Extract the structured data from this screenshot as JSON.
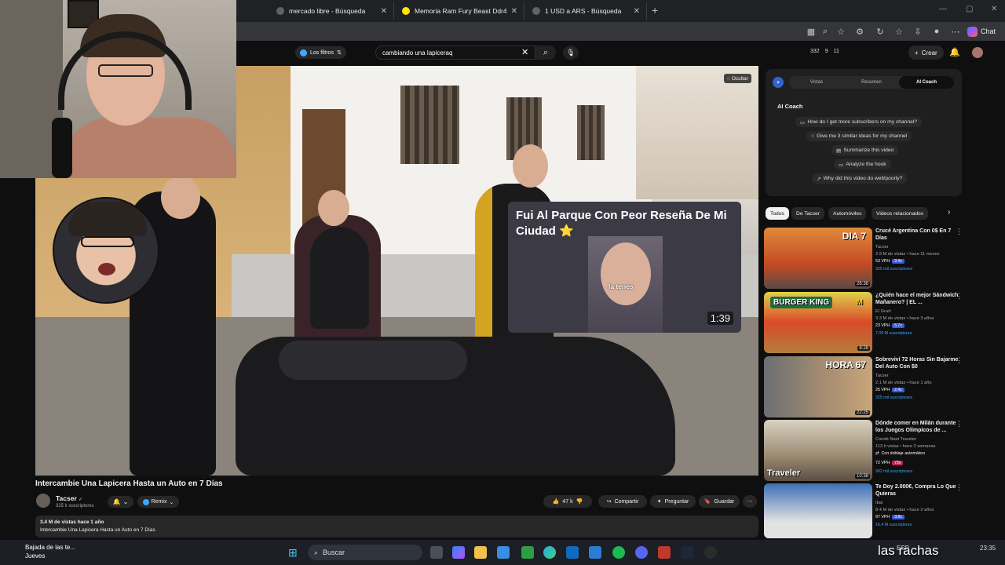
{
  "browser": {
    "tabs": [
      {
        "label": "mercado libre - Búsqueda"
      },
      {
        "label": "Memoria Ram Fury Beast Ddr4 16..."
      },
      {
        "label": "1 USD a ARS - Búsqueda"
      }
    ],
    "new_tab": "+",
    "chat_label": "Chat"
  },
  "youtube": {
    "filters_label": "Los filtros",
    "search_value": "cambiando una lapiceraq",
    "stats": [
      "332",
      "9",
      "11"
    ],
    "create_label": "Crear",
    "hide_label": "Ocultar"
  },
  "video": {
    "title": "Intercambie Una Lapicera Hasta un Auto en 7 Días",
    "channel": "Tacser",
    "subs": "325 k suscriptores",
    "remix": "Remix",
    "likes": "47 k",
    "share": "Compartir",
    "ask": "Preguntar",
    "save": "Guardar",
    "desc_line1": "3.4 M de vistas  hace 1 año",
    "desc_line2": "Intercambie Una Lapicera Hasta un Auto en 7 Días"
  },
  "preview": {
    "title": "Fui Al Parque Con Peor Reseña De Mi Ciudad",
    "star": "⭐",
    "caption": "la tenes",
    "duration": "1:39"
  },
  "ai_panel": {
    "tabs": [
      "Vistas",
      "Resumen",
      "AI Coach"
    ],
    "active_tab": "AI Coach",
    "heading": "AI Coach",
    "suggestions": [
      "How do I get more subscribers on my channel?",
      "Give me 3 similar ideas for my channel",
      "Summarize this video",
      "Analyze the hook",
      "Why did this video do well/poorly?"
    ]
  },
  "chips": [
    "Todos",
    "De Tacser",
    "Automóviles",
    "Videos relacionados"
  ],
  "related": [
    {
      "title": "Crucé Argentina Con 0$ En 7 Días",
      "channel": "Tacser",
      "meta": "2.9 M de vistas • hace 11 meses",
      "vph": "53 VPH",
      "badge": "3.4x",
      "subs": "325 mil suscriptores",
      "duration": "26:36",
      "thumb_text": "DIA 7",
      "badge_color": "#3b5bdb"
    },
    {
      "title": "¿Quién hace el mejor Sándwich Mañanero? | EL ...",
      "channel": "El Guzii",
      "meta": "3.3 M de vistas • hace 3 años",
      "vph": "23 VPH",
      "badge": "5.7x",
      "subs": "7.09 M suscriptores",
      "duration": "8:28",
      "thumb_text": "",
      "badge_color": "#3b5bdb"
    },
    {
      "title": "Sobreviví 72 Horas Sin Bajarme Del Auto Con $0",
      "channel": "Tacser",
      "meta": "2.1 M de vistas • hace 1 año",
      "vph": "25 VPH",
      "badge": "2.4x",
      "subs": "325 mil suscriptores",
      "duration": "22:25",
      "thumb_text": "HORA 67",
      "badge_color": "#3b5bdb"
    },
    {
      "title": "Dónde comer en Milán durante los Juegos Olímpicos de ...",
      "channel": "Condé Nast Traveler",
      "meta": "113 k vistas • hace 2 semanas",
      "vph": "72 VPH",
      "badge": "73x",
      "subs": "902 mil suscriptores",
      "duration": "10:38",
      "thumb_text": "Traveler",
      "extra": "Con doblaje automático",
      "badge_color": "#c2255c"
    },
    {
      "title": "Te Doy 2.000€, Compra Lo Que Quieras",
      "channel": "Ibai",
      "meta": "8.4 M de vistas • hace 2 años",
      "vph": "97 VPH",
      "badge": "3.8x",
      "subs": "16.4 M suscriptores",
      "duration": "",
      "thumb_text": "",
      "badge_color": "#3b5bdb"
    }
  ],
  "taskbar": {
    "weather_line1": "Bajada de las te...",
    "weather_line2": "Jueves",
    "search": "Buscar",
    "lang": "ESP",
    "clock": "23:35",
    "overlay": "las rachas"
  }
}
